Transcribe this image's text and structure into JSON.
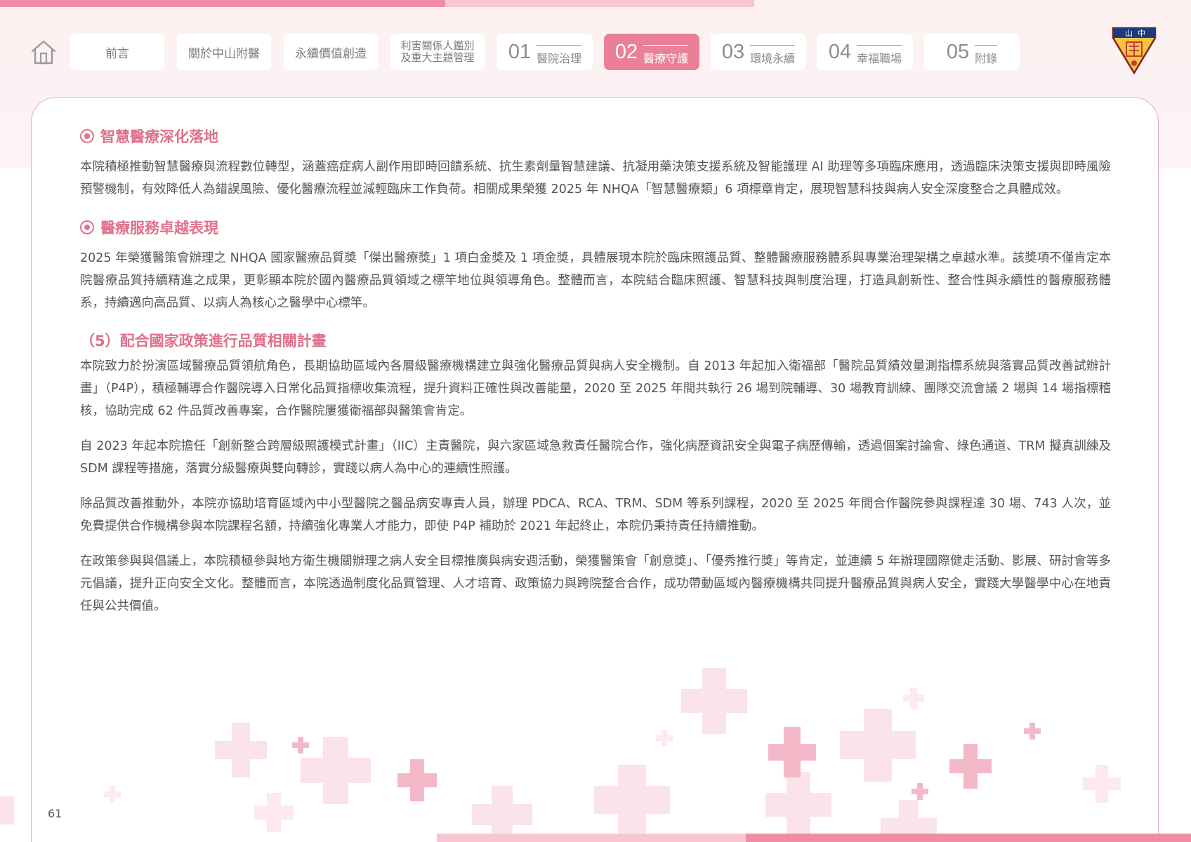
{
  "nav": {
    "home_icon": "home-icon",
    "items": [
      {
        "label": "前言"
      },
      {
        "label": "關於中山附醫"
      },
      {
        "label": "永續價值創造"
      },
      {
        "line1": "利害關係人鑑別",
        "line2": "及重大主題管理"
      },
      {
        "num": "01",
        "label": "醫院治理"
      },
      {
        "num": "02",
        "label": "醫療守護"
      },
      {
        "num": "03",
        "label": "環境永續"
      },
      {
        "num": "04",
        "label": "幸福職場"
      },
      {
        "num": "05",
        "label": "附錄"
      }
    ],
    "active_index": 5
  },
  "logo": {
    "text": "山中",
    "icon": "school-emblem-icon"
  },
  "content": {
    "section1": {
      "title": "智慧醫療深化落地",
      "para": "本院積極推動智慧醫療與流程數位轉型，涵蓋癌症病人副作用即時回饋系統、抗生素劑量智慧建議、抗凝用藥決策支援系統及智能護理 AI 助理等多項臨床應用，透過臨床決策支援與即時風險預警機制，有效降低人為錯誤風險、優化醫療流程並減輕臨床工作負荷。相關成果榮獲 2025 年 NHQA「智慧醫療類」6 項標章肯定，展現智慧科技與病人安全深度整合之具體成效。"
    },
    "section2": {
      "title": "醫療服務卓越表現",
      "para": "2025 年榮獲醫策會辦理之 NHQA 國家醫療品質獎「傑出醫療獎」1 項白金獎及 1 項金獎，具體展現本院於臨床照護品質、整體醫療服務體系與專業治理架構之卓越水準。該獎項不僅肯定本院醫療品質持續精進之成果，更彰顯本院於國內醫療品質領域之標竿地位與領導角色。整體而言，本院結合臨床照護、智慧科技與制度治理，打造具創新性、整合性與永續性的醫療服務體系，持續邁向高品質、以病人為核心之醫學中心標竿。"
    },
    "section3": {
      "title": "（5）配合國家政策進行品質相關計畫",
      "paras": [
        "本院致力於扮演區域醫療品質領航角色，長期協助區域內各層級醫療機構建立與強化醫療品質與病人安全機制。自 2013 年起加入衛福部「醫院品質績效量測指標系統與落實品質改善試辦計畫」（P4P），積極輔導合作醫院導入日常化品質指標收集流程，提升資料正確性與改善能量，2020 至 2025 年間共執行 26 場到院輔導、30 場教育訓練、團隊交流會議 2 場與 14 場指標稽核，協助完成 62 件品質改善專案，合作醫院屢獲衛福部與醫策會肯定。",
        "自 2023 年起本院擔任「創新整合跨層級照護模式計畫」（IIC）主責醫院，與六家區域急救責任醫院合作，強化病歷資訊安全與電子病歷傳輸，透過個案討論會、綠色通道、TRM 擬真訓練及 SDM 課程等措施，落實分級醫療與雙向轉診，實踐以病人為中心的連續性照護。",
        "除品質改善推動外，本院亦協助培育區域內中小型醫院之醫品病安專責人員，辦理 PDCA、RCA、TRM、SDM 等系列課程，2020 至 2025 年間合作醫院參與課程達 30 場、743 人次，並免費提供合作機構參與本院課程名額，持續強化專業人才能力，即使 P4P 補助於 2021 年起終止，本院仍秉持責任持續推動。",
        "在政策參與與倡議上，本院積極參與地方衛生機關辦理之病人安全目標推廣與病安週活動，榮獲醫策會「創意獎」、「優秀推行獎」等肯定，並連續 5 年辦理國際健走活動、影展、研討會等多元倡議，提升正向安全文化。整體而言，本院透過制度化品質管理、人才培育、政策協力與跨院整合合作，成功帶動區域內醫療機構共同提升醫療品質與病人安全，實踐大學醫學中心在地責任與公共價值。"
      ]
    }
  },
  "footer": {
    "page_number": "61"
  },
  "colors": {
    "accent": "#ea7f98",
    "heading": "#e0708c",
    "stripe_light": "#f7c6d3",
    "stripe_dark": "#ee8da4"
  }
}
